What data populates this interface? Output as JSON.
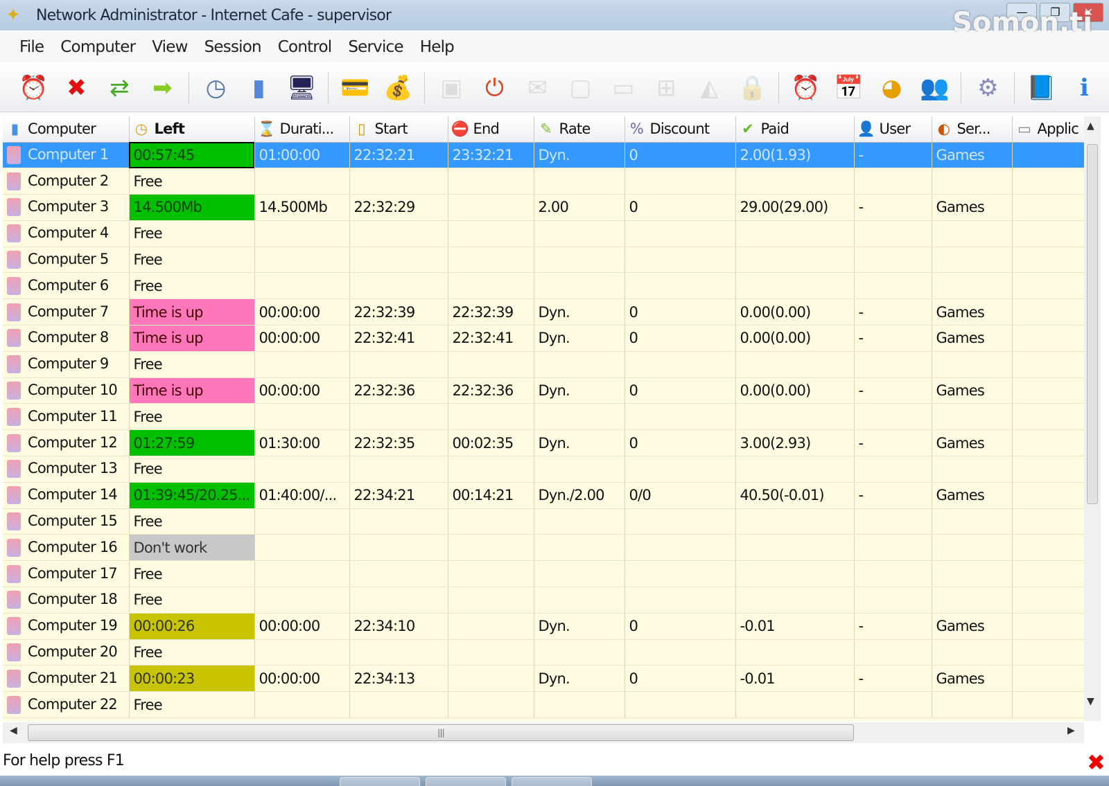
{
  "window": {
    "title": "Network Administrator - Internet Cafe - supervisor",
    "watermark": "Somon.tj"
  },
  "menu": [
    "File",
    "Computer",
    "View",
    "Session",
    "Control",
    "Service",
    "Help"
  ],
  "toolbar": [
    {
      "icon": "alarm-start-icon",
      "glyph": "⏰",
      "color": "#d33",
      "enabled": true
    },
    {
      "icon": "delete-icon",
      "glyph": "✖",
      "color": "#e01010",
      "enabled": true
    },
    {
      "icon": "transfer-icon",
      "glyph": "⇄",
      "color": "#4a2",
      "enabled": true
    },
    {
      "icon": "arrow-right-icon",
      "glyph": "➡",
      "color": "#8c2",
      "enabled": true
    },
    {
      "sep": true
    },
    {
      "icon": "clock-check-icon",
      "glyph": "◷",
      "color": "#5577aa",
      "enabled": true
    },
    {
      "icon": "computer-remove-icon",
      "glyph": "▮",
      "color": "#5588dd",
      "enabled": true
    },
    {
      "icon": "monitor-icon",
      "glyph": "🖥",
      "color": "#225",
      "enabled": true
    },
    {
      "sep": true
    },
    {
      "icon": "payment-icon",
      "glyph": "💳",
      "color": "#6a8",
      "enabled": true
    },
    {
      "icon": "money-bag-icon",
      "glyph": "💰",
      "color": "#c90",
      "enabled": true
    },
    {
      "sep": true
    },
    {
      "icon": "message-icon",
      "glyph": "▣",
      "color": "#999",
      "enabled": false
    },
    {
      "icon": "power-icon",
      "glyph": "⏻",
      "color": "#e2401a",
      "enabled": true
    },
    {
      "icon": "mail-icon",
      "glyph": "✉",
      "color": "#999",
      "enabled": false
    },
    {
      "icon": "screen-icon",
      "glyph": "▢",
      "color": "#999",
      "enabled": false
    },
    {
      "icon": "display-icon",
      "glyph": "▭",
      "color": "#999",
      "enabled": false
    },
    {
      "icon": "network-icon",
      "glyph": "⊞",
      "color": "#999",
      "enabled": false
    },
    {
      "icon": "shield-icon",
      "glyph": "◭",
      "color": "#999",
      "enabled": false
    },
    {
      "icon": "lock-icon",
      "glyph": "🔒",
      "color": "#999",
      "enabled": false
    },
    {
      "sep": true
    },
    {
      "icon": "alarm-clock-icon",
      "glyph": "⏰",
      "color": "#d22",
      "enabled": true
    },
    {
      "icon": "schedule-icon",
      "glyph": "📅",
      "color": "#c44",
      "enabled": true
    },
    {
      "icon": "report-chart-icon",
      "glyph": "◕",
      "color": "#e5a000",
      "enabled": true
    },
    {
      "icon": "users-icon",
      "glyph": "👥",
      "color": "#f0a040",
      "enabled": true
    },
    {
      "sep": true
    },
    {
      "icon": "settings-gear-icon",
      "glyph": "⚙",
      "color": "#8888bb",
      "enabled": true
    },
    {
      "sep": true
    },
    {
      "icon": "help-book-icon",
      "glyph": "📘",
      "color": "#1560c0",
      "enabled": true
    },
    {
      "icon": "info-icon",
      "glyph": "ℹ",
      "color": "#2a80e0",
      "enabled": true
    }
  ],
  "columns": [
    {
      "label": "Computer",
      "icon": "computer-icon",
      "glyph": "▮",
      "color": "#4a8fe0"
    },
    {
      "label": "Left",
      "icon": "clock-icon",
      "glyph": "◷",
      "color": "#d9a020",
      "sorted": true
    },
    {
      "label": "Durati...",
      "icon": "hourglass-icon",
      "glyph": "⌛",
      "color": "#d9a020"
    },
    {
      "label": "Start",
      "icon": "traffic-light-icon",
      "glyph": "▯",
      "color": "#c90"
    },
    {
      "label": "End",
      "icon": "stop-icon",
      "glyph": "⛔",
      "color": "#e03030"
    },
    {
      "label": "Rate",
      "icon": "rate-icon",
      "glyph": "✎",
      "color": "#8b3"
    },
    {
      "label": "Discount",
      "icon": "discount-icon",
      "glyph": "%",
      "color": "#66a"
    },
    {
      "label": "Paid",
      "icon": "paid-icon",
      "glyph": "✔",
      "color": "#6b2"
    },
    {
      "label": "User",
      "icon": "user-icon",
      "glyph": "👤",
      "color": "#c60"
    },
    {
      "label": "Ser...",
      "icon": "service-icon",
      "glyph": "◐",
      "color": "#c50"
    },
    {
      "label": "Applic",
      "icon": "application-icon",
      "glyph": "▭",
      "color": "#888"
    }
  ],
  "rows": [
    {
      "computer": "Computer 1",
      "left": "00:57:45",
      "status": "green",
      "duration": "01:00:00",
      "start": "22:32:21",
      "end": "23:32:21",
      "rate": "Dyn.",
      "discount": "0",
      "paid": "2.00(1.93)",
      "user": "-",
      "service": "Games",
      "app": "",
      "selected": true
    },
    {
      "computer": "Computer 2",
      "left": "Free",
      "status": "free"
    },
    {
      "computer": "Computer 3",
      "left": "14.500Mb",
      "status": "green",
      "duration": "14.500Mb",
      "start": "22:32:29",
      "end": "",
      "rate": "2.00",
      "discount": "0",
      "paid": "29.00(29.00)",
      "user": "-",
      "service": "Games"
    },
    {
      "computer": "Computer 4",
      "left": "Free",
      "status": "free"
    },
    {
      "computer": "Computer 5",
      "left": "Free",
      "status": "free"
    },
    {
      "computer": "Computer 6",
      "left": "Free",
      "status": "free"
    },
    {
      "computer": "Computer 7",
      "left": "Time is up",
      "status": "pink",
      "duration": "00:00:00",
      "start": "22:32:39",
      "end": "22:32:39",
      "rate": "Dyn.",
      "discount": "0",
      "paid": "0.00(0.00)",
      "user": "-",
      "service": "Games"
    },
    {
      "computer": "Computer 8",
      "left": "Time is up",
      "status": "pink",
      "duration": "00:00:00",
      "start": "22:32:41",
      "end": "22:32:41",
      "rate": "Dyn.",
      "discount": "0",
      "paid": "0.00(0.00)",
      "user": "-",
      "service": "Games"
    },
    {
      "computer": "Computer 9",
      "left": "Free",
      "status": "free"
    },
    {
      "computer": "Computer 10",
      "left": "Time is up",
      "status": "pink",
      "duration": "00:00:00",
      "start": "22:32:36",
      "end": "22:32:36",
      "rate": "Dyn.",
      "discount": "0",
      "paid": "0.00(0.00)",
      "user": "-",
      "service": "Games"
    },
    {
      "computer": "Computer 11",
      "left": "Free",
      "status": "free"
    },
    {
      "computer": "Computer 12",
      "left": "01:27:59",
      "status": "green",
      "duration": "01:30:00",
      "start": "22:32:35",
      "end": "00:02:35",
      "rate": "Dyn.",
      "discount": "0",
      "paid": "3.00(2.93)",
      "user": "-",
      "service": "Games"
    },
    {
      "computer": "Computer 13",
      "left": "Free",
      "status": "free"
    },
    {
      "computer": "Computer 14",
      "left": "01:39:45/20.25...",
      "status": "green",
      "duration": "01:40:00/...",
      "start": "22:34:21",
      "end": "00:14:21",
      "rate": "Dyn./2.00",
      "discount": "0/0",
      "paid": "40.50(-0.01)",
      "user": "-",
      "service": "Games"
    },
    {
      "computer": "Computer 15",
      "left": "Free",
      "status": "free"
    },
    {
      "computer": "Computer 16",
      "left": "Don't work",
      "status": "gray"
    },
    {
      "computer": "Computer 17",
      "left": "Free",
      "status": "free"
    },
    {
      "computer": "Computer 18",
      "left": "Free",
      "status": "free"
    },
    {
      "computer": "Computer 19",
      "left": "00:00:26",
      "status": "olive",
      "duration": "00:00:00",
      "start": "22:34:10",
      "end": "",
      "rate": "Dyn.",
      "discount": "0",
      "paid": "-0.01",
      "user": "-",
      "service": "Games"
    },
    {
      "computer": "Computer 20",
      "left": "Free",
      "status": "free"
    },
    {
      "computer": "Computer 21",
      "left": "00:00:23",
      "status": "olive",
      "duration": "00:00:00",
      "start": "22:34:13",
      "end": "",
      "rate": "Dyn.",
      "discount": "0",
      "paid": "-0.01",
      "user": "-",
      "service": "Games"
    },
    {
      "computer": "Computer 22",
      "left": "Free",
      "status": "free"
    }
  ],
  "status_bar": {
    "text": "For help press F1"
  }
}
